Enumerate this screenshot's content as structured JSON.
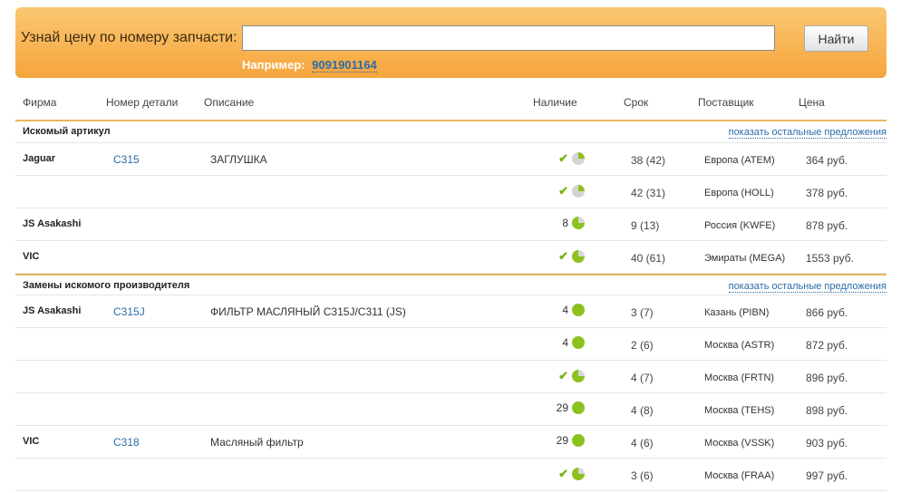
{
  "search": {
    "label": "Узнай цену по номеру запчасти:",
    "input_value": "",
    "button_label": "Найти",
    "example_label": "Например:",
    "example_value": "9091901164"
  },
  "headers": {
    "firm": "Фирма",
    "number": "Номер детали",
    "description": "Описание",
    "availability": "Наличие",
    "term": "Срок",
    "supplier": "Поставщик",
    "price": "Цена"
  },
  "sections": [
    {
      "title": "Искомый артикул",
      "link": "показать остальные предложения",
      "rows": [
        {
          "firm": "Jaguar",
          "number": "C315",
          "description": "ЗАГЛУШКА",
          "avail_count": "",
          "avail_check": true,
          "pie": "quarter",
          "term": "38 (42)",
          "supplier": "Европа (ATEM)",
          "price": "364 руб."
        },
        {
          "firm": "",
          "number": "",
          "description": "",
          "avail_count": "",
          "avail_check": true,
          "pie": "quarter",
          "term": "42 (31)",
          "supplier": "Европа (HOLL)",
          "price": "378 руб."
        },
        {
          "firm": "JS Asakashi",
          "number": "",
          "description": "",
          "avail_count": "8",
          "avail_check": false,
          "pie": "three",
          "term": "9 (13)",
          "supplier": "Россия (KWFE)",
          "price": "878 руб."
        },
        {
          "firm": "VIC",
          "number": "",
          "description": "",
          "avail_count": "",
          "avail_check": true,
          "pie": "three",
          "term": "40 (61)",
          "supplier": "Эмираты (MEGA)",
          "price": "1553 руб."
        }
      ]
    },
    {
      "title": "Замены искомого производителя",
      "link": "показать остальные предложения",
      "rows": [
        {
          "firm": "JS Asakashi",
          "number": "C315J",
          "description": "ФИЛЬТР МАСЛЯНЫЙ C315J/C311 (JS)",
          "avail_count": "4",
          "avail_check": false,
          "pie": "full",
          "term": "3 (7)",
          "supplier": "Казань (PIBN)",
          "price": "866 руб."
        },
        {
          "firm": "",
          "number": "",
          "description": "",
          "avail_count": "4",
          "avail_check": false,
          "pie": "full",
          "term": "2 (6)",
          "supplier": "Москва (ASTR)",
          "price": "872 руб."
        },
        {
          "firm": "",
          "number": "",
          "description": "",
          "avail_count": "",
          "avail_check": true,
          "pie": "three",
          "term": "4 (7)",
          "supplier": "Москва (FRTN)",
          "price": "896 руб."
        },
        {
          "firm": "",
          "number": "",
          "description": "",
          "avail_count": "29",
          "avail_check": false,
          "pie": "full",
          "term": "4 (8)",
          "supplier": "Москва (TEHS)",
          "price": "898 руб."
        },
        {
          "firm": "VIC",
          "number": "C318",
          "description": "Масляный фильтр",
          "avail_count": "29",
          "avail_check": false,
          "pie": "full",
          "term": "4 (6)",
          "supplier": "Москва (VSSK)",
          "price": "903 руб."
        },
        {
          "firm": "",
          "number": "",
          "description": "",
          "avail_count": "",
          "avail_check": true,
          "pie": "three",
          "term": "3 (6)",
          "supplier": "Москва (FRAA)",
          "price": "997 руб."
        }
      ]
    }
  ],
  "colors": {
    "accent": "#f6a53c",
    "link": "#2a6ca8",
    "ok": "#8cc21f"
  },
  "icons": {
    "check": "check-icon",
    "stock": "stock-pie-icon"
  }
}
